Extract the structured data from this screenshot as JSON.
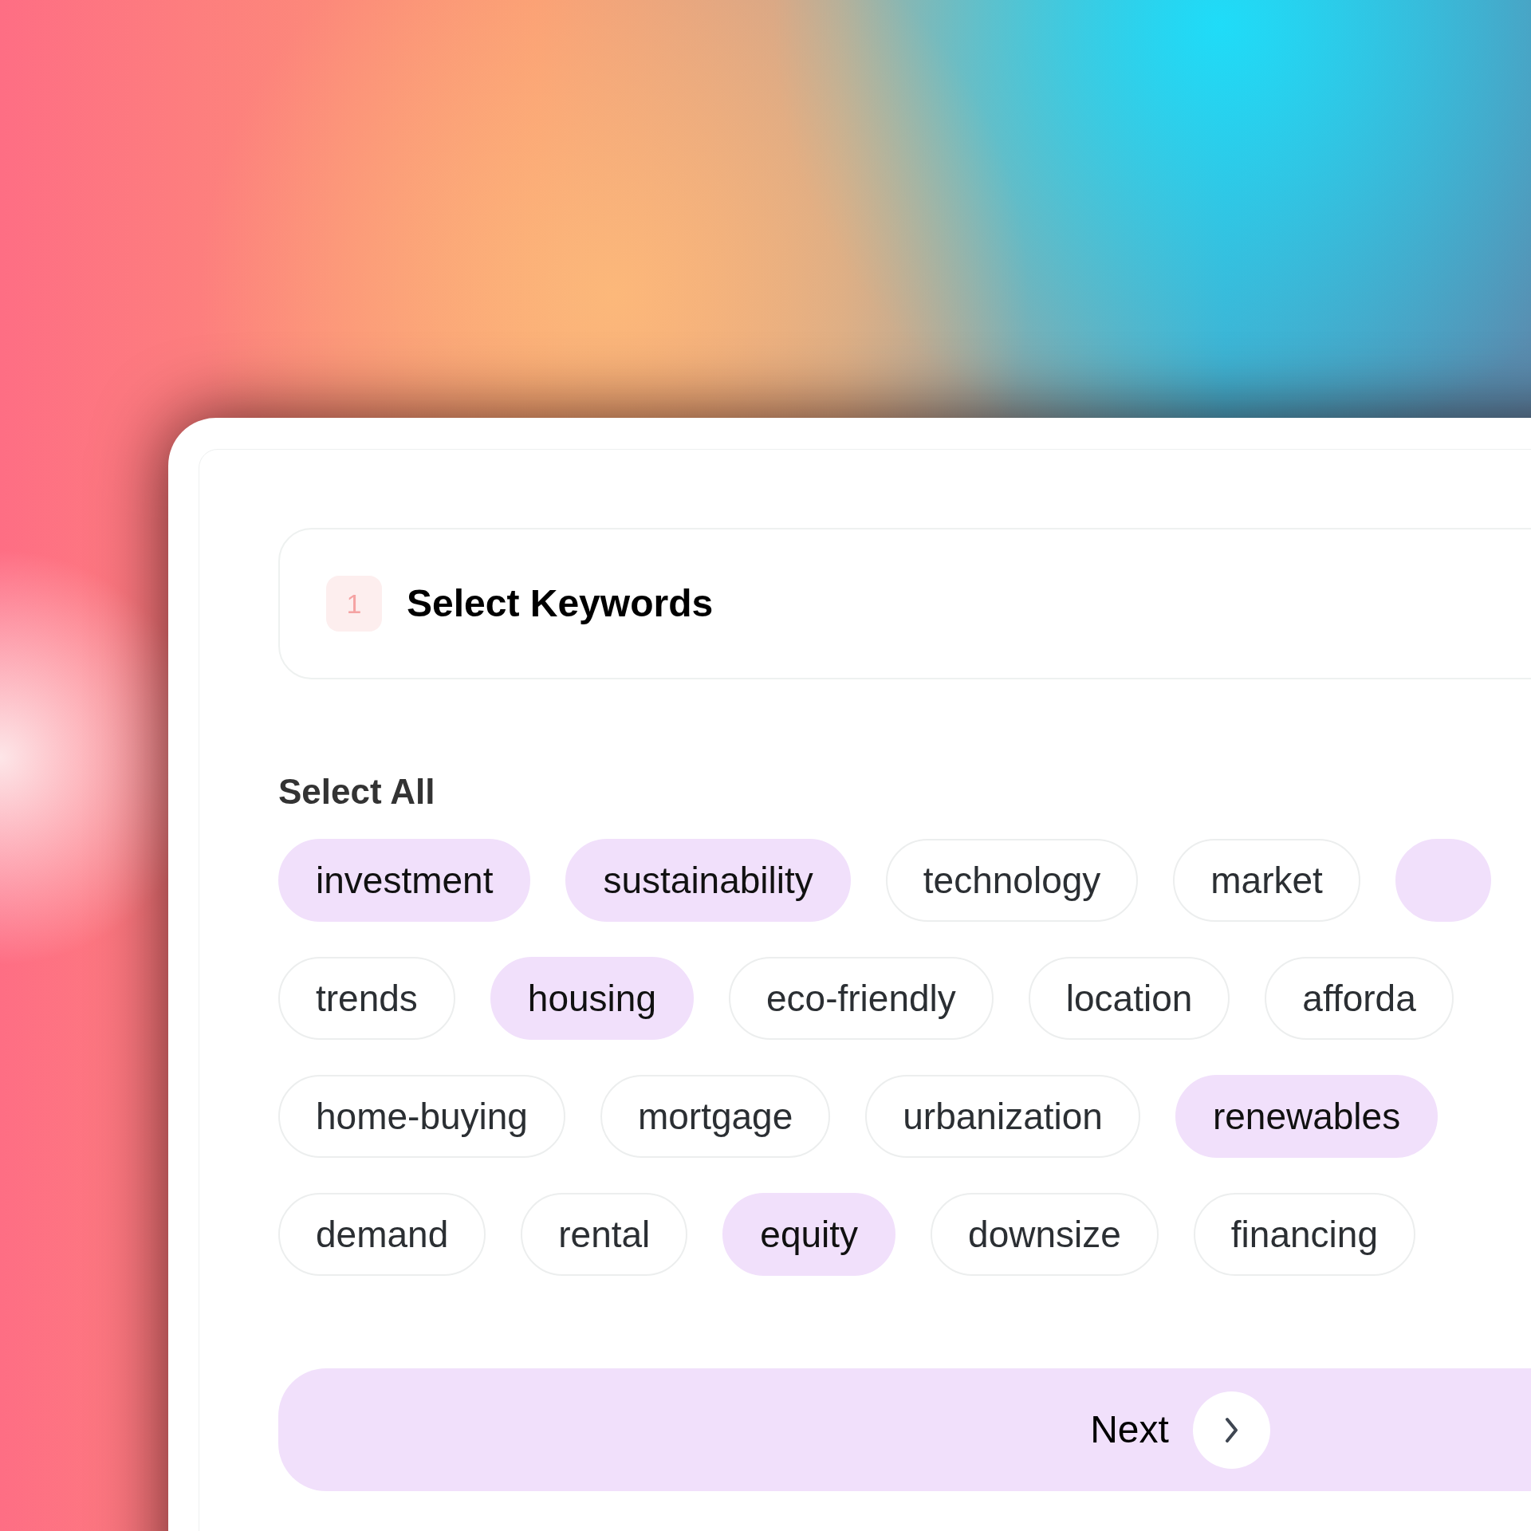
{
  "step": {
    "number": "1",
    "title": "Select Keywords"
  },
  "select_all": "Select All",
  "keyword_rows": [
    {
      "chips": [
        {
          "label": "investment",
          "selected": true
        },
        {
          "label": "sustainability",
          "selected": true
        },
        {
          "label": "technology",
          "selected": false
        },
        {
          "label": "market",
          "selected": false
        },
        {
          "selected": true
        }
      ]
    },
    {
      "chips": [
        {
          "label": "trends",
          "selected": false
        },
        {
          "label": "housing",
          "selected": true
        },
        {
          "label": "eco-friendly",
          "selected": false
        },
        {
          "label": "location",
          "selected": false
        },
        {
          "label": "afforda",
          "selected": false
        }
      ]
    },
    {
      "chips": [
        {
          "label": "home-buying",
          "selected": false
        },
        {
          "label": "mortgage",
          "selected": false
        },
        {
          "label": "urbanization",
          "selected": false
        },
        {
          "label": "renewables",
          "selected": true
        }
      ]
    },
    {
      "chips": [
        {
          "label": "demand",
          "selected": false
        },
        {
          "label": "rental",
          "selected": false
        },
        {
          "label": "equity",
          "selected": true
        },
        {
          "label": "downsize",
          "selected": false
        },
        {
          "label": "financing",
          "selected": false
        }
      ]
    }
  ],
  "next_button": {
    "label": "Next"
  }
}
